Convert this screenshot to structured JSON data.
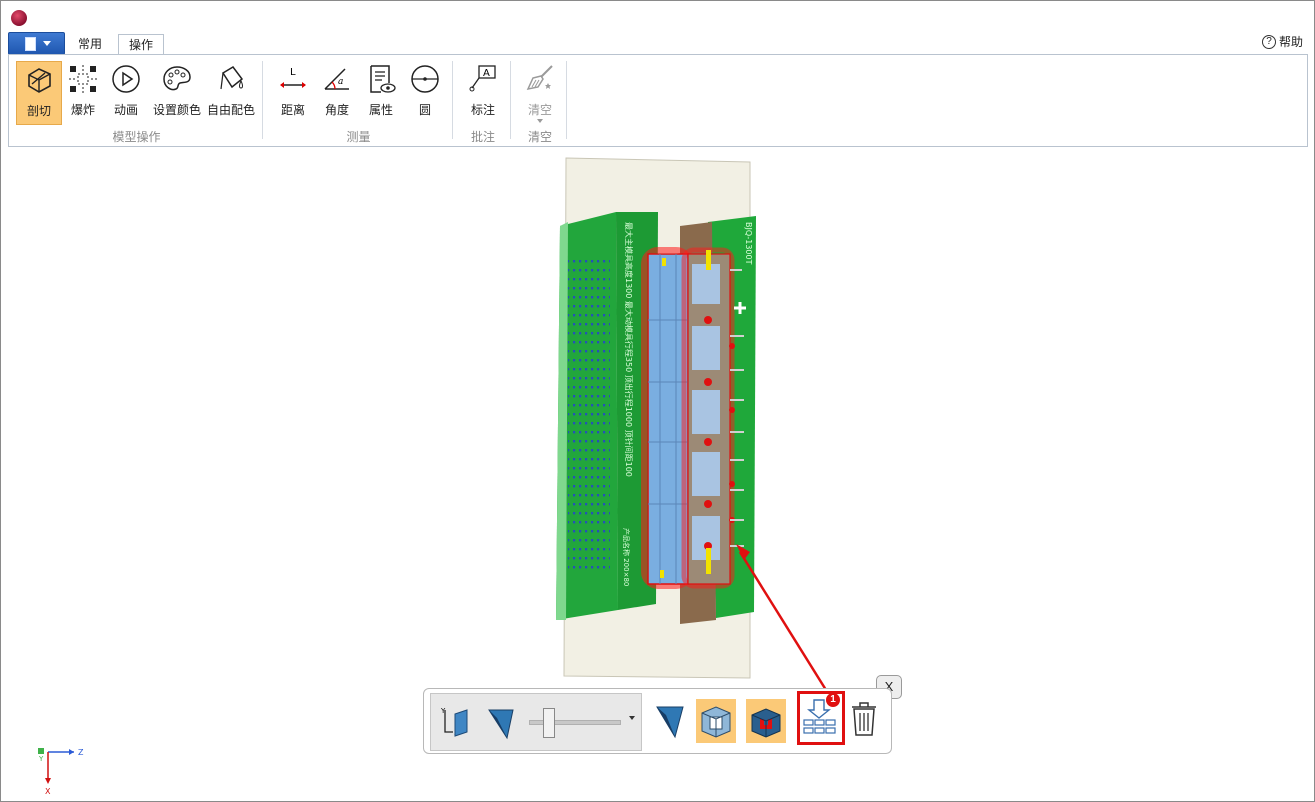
{
  "menu": {
    "tabs": [
      {
        "label": "常用"
      },
      {
        "label": "操作"
      }
    ],
    "help_label": "帮助"
  },
  "ribbon": {
    "groups": [
      {
        "label": "模型操作",
        "buttons": [
          {
            "label": "剖切"
          },
          {
            "label": "爆炸"
          },
          {
            "label": "动画"
          },
          {
            "label": "设置颜色"
          },
          {
            "label": "自由配色"
          }
        ]
      },
      {
        "label": "测量",
        "buttons": [
          {
            "label": "距离"
          },
          {
            "label": "角度"
          },
          {
            "label": "属性"
          },
          {
            "label": "圆"
          }
        ]
      },
      {
        "label": "批注",
        "buttons": [
          {
            "label": "标注"
          }
        ]
      },
      {
        "label": "清空",
        "buttons": [
          {
            "label": "清空"
          }
        ]
      }
    ]
  },
  "icons": {
    "distance_mark": "L",
    "angle_mark": "a",
    "note_mark": "A"
  },
  "model": {
    "left_plate_text": "最大主模具高度1300 最大动模具行程350 顶出行程1000 顶针间距100",
    "left_plate_text2": "产品名称  200×80",
    "right_plate_text": "BJQ-1300T"
  },
  "section_toolbar": {
    "badge": "1",
    "close_label": "X"
  },
  "axis": {
    "x": "X",
    "y": "Y",
    "z": "Z"
  },
  "colors": {
    "accent": "#fbc977",
    "highlight_red": "#e01010",
    "plate_green": "#1fa83a",
    "mold_blue": "#6fa3d6"
  }
}
